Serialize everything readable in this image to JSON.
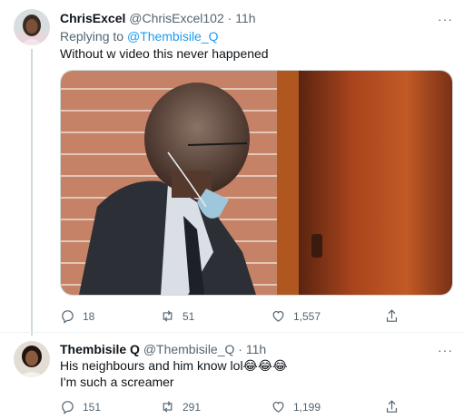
{
  "tweet1": {
    "name": "ChrisExcel",
    "handle": "@ChrisExcel102",
    "dot": "·",
    "time": "11h",
    "replying_prefix": "Replying to ",
    "replying_to": "@Thembisile_Q",
    "text": "Without w video this never happened",
    "more": "···",
    "replies": "18",
    "retweets": "51",
    "likes": "1,557"
  },
  "tweet2": {
    "name": "Thembisile Q",
    "handle": "@Thembisile_Q",
    "dot": "·",
    "time": "11h",
    "text_line1": "His neighbours and him know lol😂😂😂",
    "text_line2": "I'm such a screamer",
    "more": "···",
    "replies": "151",
    "retweets": "291",
    "likes": "1,199"
  },
  "icons": [
    "reply-icon",
    "retweet-icon",
    "like-icon",
    "share-icon"
  ],
  "colors": {
    "link": "#1d9bf0",
    "secondary": "#536471",
    "text": "#0f1419"
  }
}
